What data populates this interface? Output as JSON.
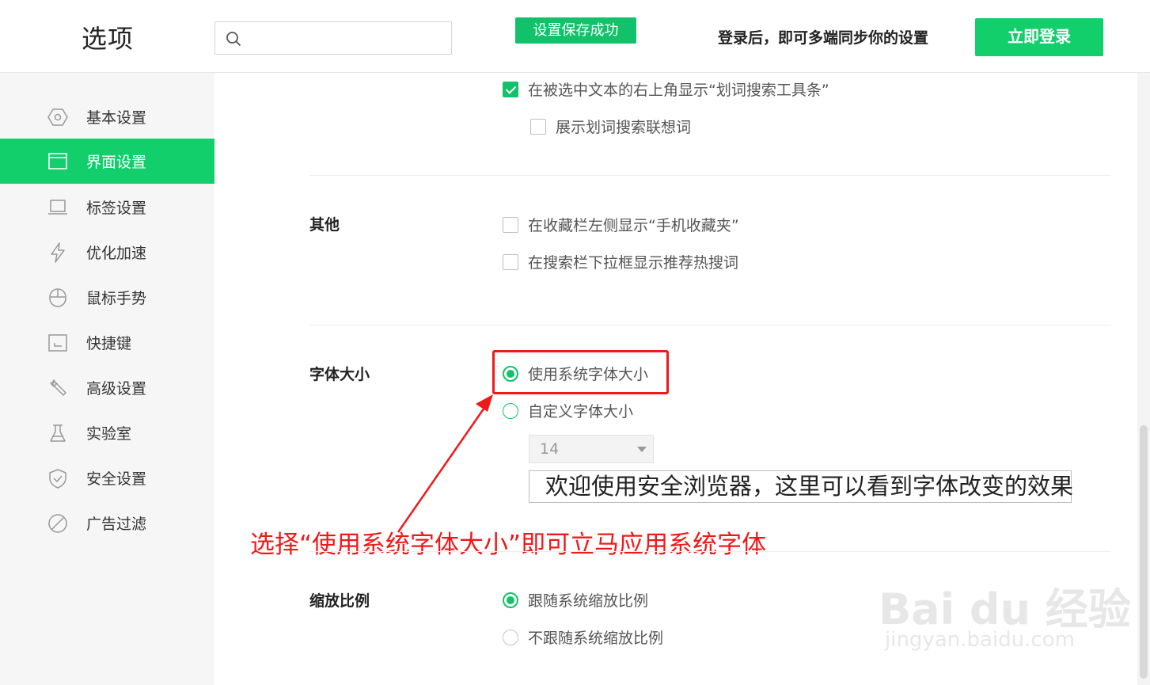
{
  "header": {
    "title": "选项",
    "search_placeholder": "",
    "toast": "设置保存成功",
    "login_tip": "登录后，即可多端同步你的设置",
    "login_button": "立即登录"
  },
  "sidebar": {
    "items": [
      {
        "label": "基本设置",
        "icon": "hexagon-settings-icon",
        "active": false
      },
      {
        "label": "界面设置",
        "icon": "window-icon",
        "active": true
      },
      {
        "label": "标签设置",
        "icon": "tab-icon",
        "active": false
      },
      {
        "label": "优化加速",
        "icon": "lightning-icon",
        "active": false
      },
      {
        "label": "鼠标手势",
        "icon": "mouse-icon",
        "active": false
      },
      {
        "label": "快捷键",
        "icon": "keyboard-icon",
        "active": false
      },
      {
        "label": "高级设置",
        "icon": "wrench-icon",
        "active": false
      },
      {
        "label": "实验室",
        "icon": "flask-icon",
        "active": false
      },
      {
        "label": "安全设置",
        "icon": "shield-icon",
        "active": false
      },
      {
        "label": "广告过滤",
        "icon": "block-icon",
        "active": false
      }
    ]
  },
  "content": {
    "word_search": {
      "show_toolbar": {
        "label": "在被选中文本的右上角显示“划词搜索工具条”",
        "checked": true
      },
      "show_suggest": {
        "label": "展示划词搜索联想词",
        "checked": false
      }
    },
    "other": {
      "title": "其他",
      "options": [
        {
          "label": "在收藏栏左侧显示“手机收藏夹”",
          "checked": false
        },
        {
          "label": "在搜索栏下拉框显示推荐热搜词",
          "checked": false
        }
      ]
    },
    "font_size": {
      "title": "字体大小",
      "use_system": {
        "label": "使用系统字体大小",
        "selected": true
      },
      "custom": {
        "label": "自定义字体大小",
        "selected": false
      },
      "size_value": "14",
      "preview_text": "欢迎使用安全浏览器，这里可以看到字体改变的效果"
    },
    "zoom": {
      "title": "缩放比例",
      "follow_system": {
        "label": "跟随系统缩放比例",
        "selected": true
      },
      "not_follow": {
        "label": "不跟随系统缩放比例",
        "selected": false
      }
    }
  },
  "annotation": {
    "text": "选择“使用系统字体大小”即可立马应用系统字体",
    "color": "#f0191a"
  },
  "watermark": {
    "main": "Bai du 经验",
    "sub": "jingyan.baidu.com"
  },
  "colors": {
    "accent": "#12cf6c",
    "annotation": "#f0191a"
  }
}
